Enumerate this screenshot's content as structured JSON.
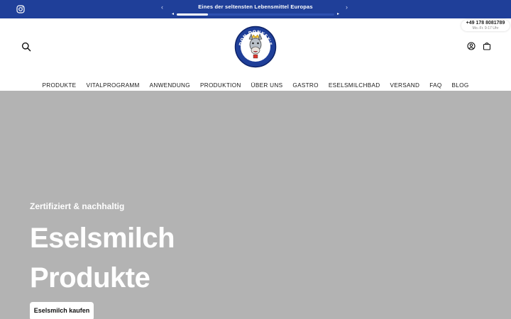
{
  "topbar": {
    "message": "Eines der seltensten Lebensmittel Europas",
    "prev_arrow": "‹",
    "next_arrow": "›",
    "scroll_left": "◂",
    "scroll_right": "▸",
    "background": "#1f3f99"
  },
  "header": {
    "logo": {
      "top_text": "DON DONKEY'S",
      "bottom_text": "MILK AND CHEESE"
    },
    "phone": {
      "number": "+49 178 8081789",
      "hours": "Mo.-Fr. 9-17 Uhr"
    },
    "icons": [
      "instagram-icon",
      "search-icon",
      "account-icon",
      "cart-icon"
    ]
  },
  "nav": {
    "items": [
      "PRODUKTE",
      "VITALPROGRAMM",
      "ANWENDUNG",
      "PRODUKTION",
      "ÜBER UNS",
      "GASTRO",
      "ESELSMILCHBAD",
      "VERSAND",
      "FAQ",
      "BLOG"
    ]
  },
  "hero": {
    "eyebrow": "Zertifiziert & nachhaltig",
    "headline_line1": "Eselsmilch",
    "headline_line2": "Produkte",
    "cta": "Eselsmilch kaufen",
    "background": "#b3b3b3"
  }
}
